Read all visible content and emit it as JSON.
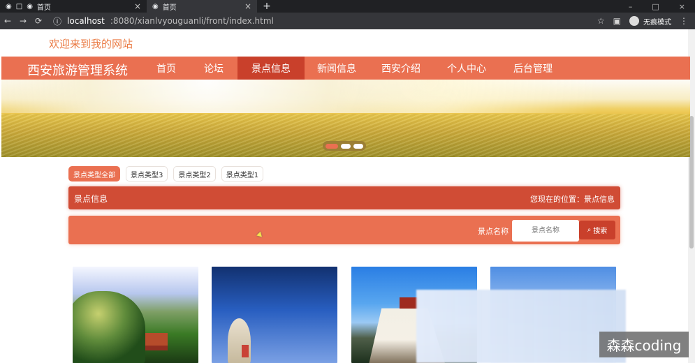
{
  "browser": {
    "tabs": [
      {
        "label": "首页",
        "active": false
      },
      {
        "label": "首页",
        "active": true
      }
    ],
    "url_host": "localhost",
    "url_path": ":8080/xianlvyouguanli/front/index.html",
    "profile_label": "无痕模式"
  },
  "page": {
    "welcome": "欢迎来到我的网站",
    "brand": "西安旅游管理系统",
    "menu": [
      "首页",
      "论坛",
      "景点信息",
      "新闻信息",
      "西安介绍",
      "个人中心",
      "后台管理"
    ],
    "type_tags": [
      "景点类型全部",
      "景点类型3",
      "景点类型2",
      "景点类型1"
    ],
    "section_title": "景点信息",
    "breadcrumb": "您现在的位置：景点信息",
    "search": {
      "label": "景点名称",
      "placeholder": "景点名称",
      "button": "搜索"
    },
    "watermark": "森森coding"
  },
  "colors": {
    "primary": "#ea7051",
    "primary_dark": "#d04c35",
    "accent": "#ea7a43"
  },
  "icons": {
    "home": "globe-icon",
    "search": "search-icon"
  }
}
